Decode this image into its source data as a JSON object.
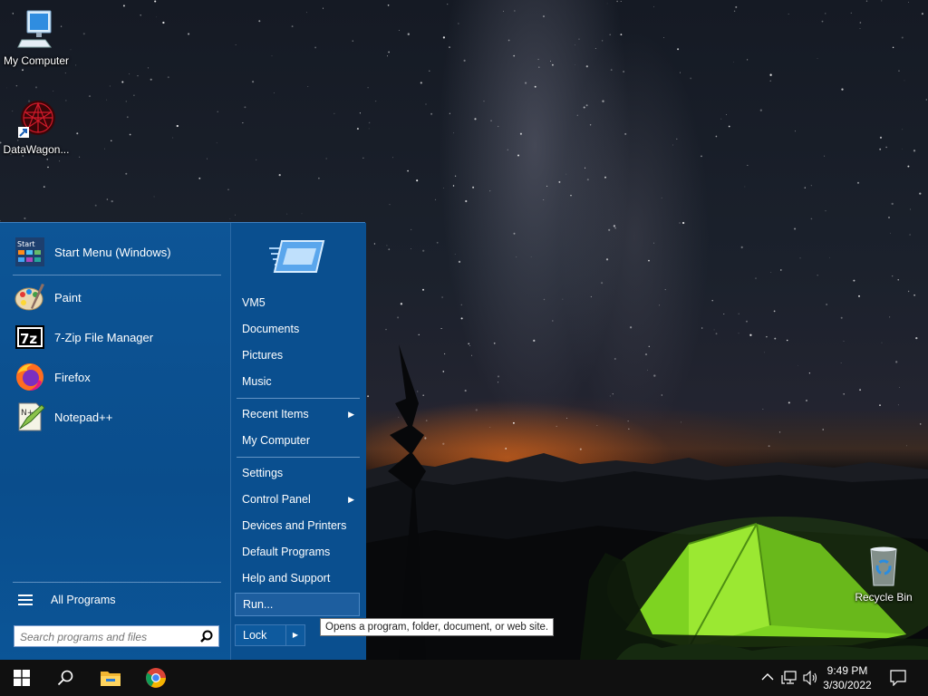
{
  "desktop": {
    "icons": [
      {
        "label": "My Computer"
      },
      {
        "label": "DataWagon..."
      },
      {
        "label": "Recycle Bin"
      }
    ]
  },
  "start_menu": {
    "pinned": [
      {
        "label": "Start Menu (Windows)",
        "icon": "start-menu-icon"
      },
      {
        "label": "Paint",
        "icon": "paint-icon"
      },
      {
        "label": "7-Zip File Manager",
        "icon": "7zip-icon"
      },
      {
        "label": "Firefox",
        "icon": "firefox-icon"
      },
      {
        "label": "Notepad++",
        "icon": "notepadpp-icon"
      }
    ],
    "all_programs": "All Programs",
    "search_placeholder": "Search programs and files",
    "right_items": [
      {
        "label": "VM5"
      },
      {
        "label": "Documents"
      },
      {
        "label": "Pictures"
      },
      {
        "label": "Music"
      },
      {
        "label": "Recent Items",
        "submenu": true
      },
      {
        "label": "My Computer"
      },
      {
        "label": "Settings"
      },
      {
        "label": "Control Panel",
        "submenu": true
      },
      {
        "label": "Devices and Printers"
      },
      {
        "label": "Default Programs"
      },
      {
        "label": "Help and Support"
      },
      {
        "label": "Run...",
        "hover": true
      }
    ],
    "lock_label": "Lock",
    "tooltip": "Opens a program, folder, document, or web site."
  },
  "taskbar": {
    "buttons": [
      "windows-start-icon",
      "search-icon",
      "file-explorer-icon",
      "chrome-icon"
    ],
    "time": "9:49 PM",
    "date": "3/30/2022"
  },
  "colors": {
    "menu_blue": "#0b5394",
    "taskbar": "#101010"
  }
}
